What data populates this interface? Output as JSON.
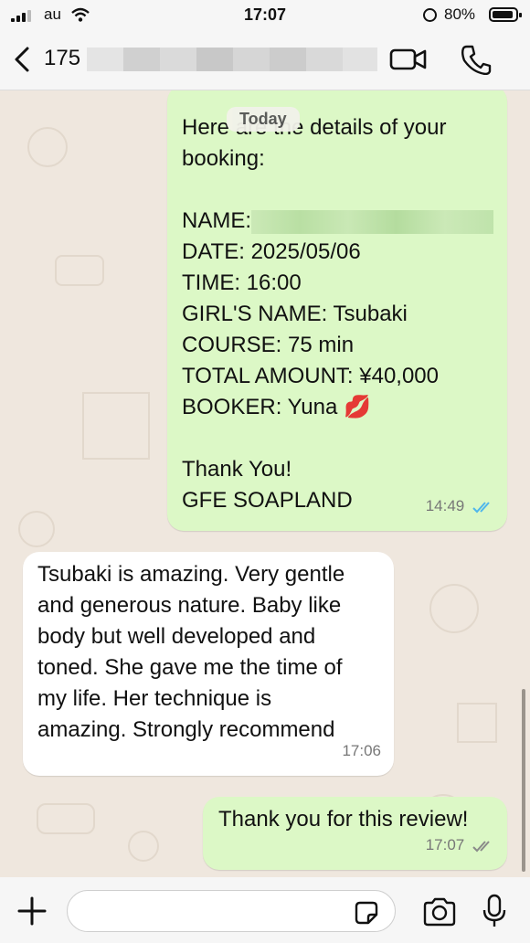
{
  "status": {
    "carrier": "au",
    "time": "17:07",
    "battery": "80%"
  },
  "header": {
    "contact_prefix": "175"
  },
  "chat": {
    "date_label": "Today",
    "booking": {
      "lines": [
        "Here are the details of your",
        "booking:",
        "",
        "DATE: 2025/05/06",
        "TIME: 16:00",
        "GIRL'S NAME: Tsubaki",
        "COURSE: 75 min",
        "TOTAL AMOUNT: ¥40,000",
        "BOOKER: Yuna",
        "",
        "Thank You!",
        "GFE SOAPLAND"
      ],
      "name_label": "NAME:",
      "emoji": "💋",
      "time": "14:49"
    },
    "review": {
      "lines": [
        "Tsubaki is amazing. Very gentle",
        "and generous nature. Baby like",
        "body but well developed and",
        "toned. She gave me the time of",
        "my life. Her technique is",
        "amazing. Strongly recommend"
      ],
      "time": "17:06"
    },
    "reply": {
      "text": "Thank you for this review!",
      "time": "17:07"
    }
  },
  "colors": {
    "outgoing": "#dcf8c6",
    "incoming": "#ffffff",
    "read_ticks": "#4fb6ec",
    "background": "#efe7de"
  },
  "icons": [
    "back-chevron-icon",
    "video-call-icon",
    "phone-call-icon",
    "plus-icon",
    "sticker-icon",
    "camera-icon",
    "microphone-icon",
    "double-check-icon"
  ]
}
